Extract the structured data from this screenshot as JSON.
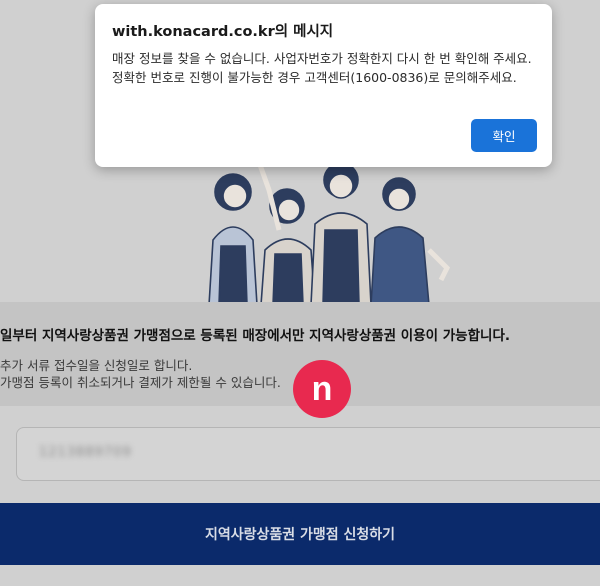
{
  "dialog": {
    "title": "with.konacard.co.kr의 메시지",
    "message": "매장 정보를 찾을 수 없습니다. 사업자번호가 정확한지 다시 한 번 확인해 주세요. 정확한 번호로 진행이 불가능한 경우 고객센터(1600-0836)로 문의해주세요.",
    "ok_label": "확인"
  },
  "notice": {
    "title": "일부터 지역사랑상품권 가맹점으로 등록된 매장에서만 지역사랑상품권 이용이 가능합니다.",
    "line1": "추가 서류 접수일을 신청일로 합니다.",
    "line2": "가맹점 등록이 취소되거나 결제가 제한될 수 있습니다."
  },
  "badge": {
    "letter": "n",
    "color": "#e8294f"
  },
  "business_number": {
    "value": "1213889709"
  },
  "apply_button": {
    "label": "지역사랑상품권 가맹점 신청하기"
  },
  "colors": {
    "primary_button": "#0b2a6b",
    "dialog_button": "#1a73d9",
    "overlay": "#d0d0d0"
  }
}
